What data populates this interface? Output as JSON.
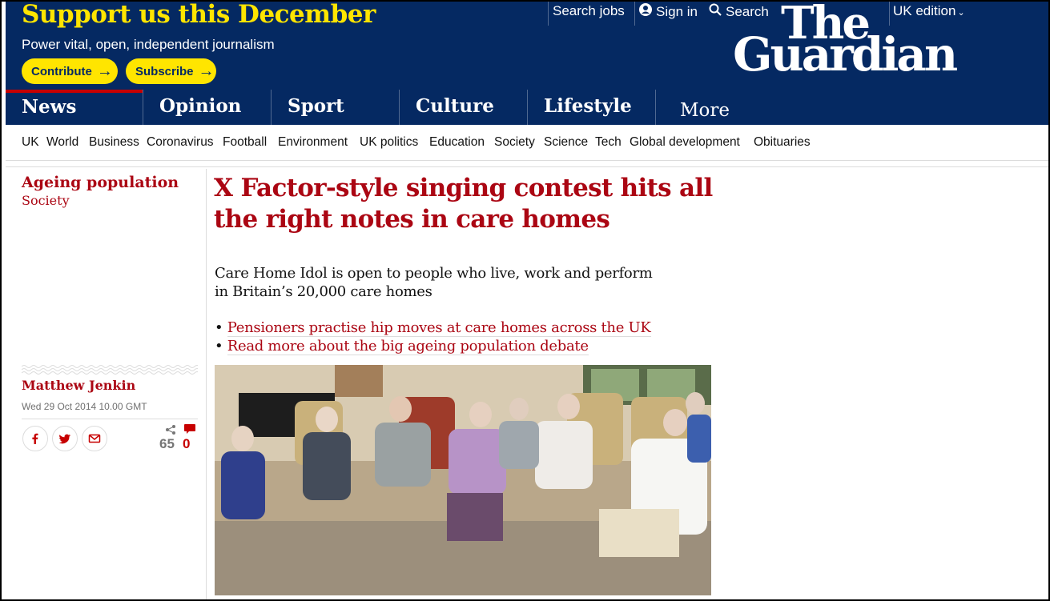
{
  "header": {
    "support_title": "Support us this December",
    "support_subtitle": "Power vital, open, independent journalism",
    "contribute_label": "Contribute",
    "subscribe_label": "Subscribe",
    "search_jobs": "Search jobs",
    "sign_in": "Sign in",
    "search": "Search",
    "edition": "UK edition",
    "logo_line1": "The",
    "logo_line2": "Guardian"
  },
  "pillars": [
    {
      "label": "News",
      "active": true
    },
    {
      "label": "Opinion"
    },
    {
      "label": "Sport"
    },
    {
      "label": "Culture"
    },
    {
      "label": "Lifestyle"
    },
    {
      "label": "More"
    }
  ],
  "subnav": [
    "UK",
    "World",
    "Business",
    "Coronavirus",
    "Football",
    "Environment",
    "UK politics",
    "Education",
    "Society",
    "Science",
    "Tech",
    "Global development",
    "Obituaries"
  ],
  "article": {
    "series": "Ageing population",
    "section": "Society",
    "headline": "X Factor-style singing contest hits all the right notes in care homes",
    "standfirst": "Care Home Idol is open to people who live, work and perform in Britain’s 20,000 care homes",
    "related": [
      "Pensioners practise hip moves at care homes across the UK",
      "Read more about the big ageing population debate"
    ],
    "author": "Matthew Jenkin",
    "date": "Wed 29 Oct 2014 10.00 GMT",
    "share_count": "65",
    "comment_count": "0"
  },
  "colors": {
    "brand_blue": "#052962",
    "support_yellow": "#ffe500",
    "news_red": "#ab0613",
    "active_red": "#c70000"
  },
  "icons": [
    "user-icon",
    "search-icon",
    "chevron-down-icon",
    "arrow-right-icon",
    "facebook-icon",
    "twitter-icon",
    "email-icon",
    "share-icon",
    "comment-icon"
  ]
}
